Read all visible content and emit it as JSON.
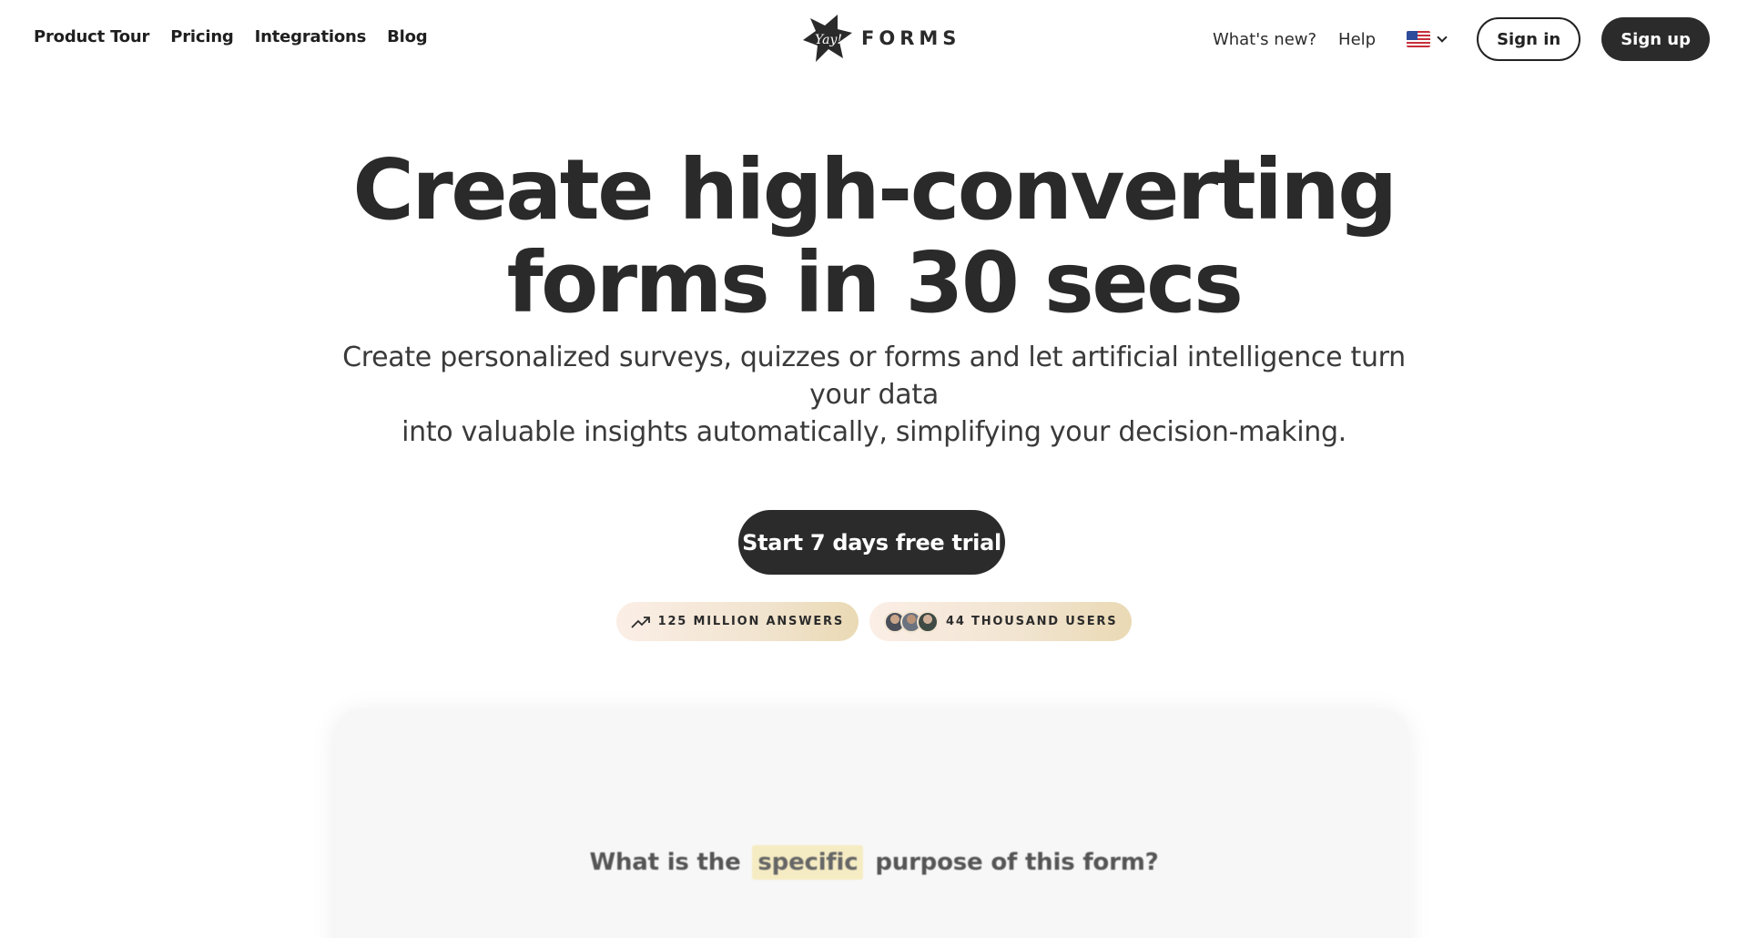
{
  "header": {
    "nav_left": [
      {
        "label": "Product Tour"
      },
      {
        "label": "Pricing"
      },
      {
        "label": "Integrations"
      },
      {
        "label": "Blog"
      }
    ],
    "logo": {
      "mark_text": "Yay!",
      "text": "FORMS"
    },
    "nav_right": {
      "whats_new": "What's new?",
      "help": "Help",
      "language_icon": "us-flag-icon",
      "sign_in": "Sign in",
      "sign_up": "Sign up"
    }
  },
  "hero": {
    "title_line1": "Create high-converting",
    "title_line2": "forms in 30 secs",
    "subtitle_line1": "Create personalized surveys, quizzes or forms and let artificial intelligence turn your data",
    "subtitle_line2": "into valuable insights automatically, simplifying your decision-making.",
    "cta_label": "Start 7 days free trial",
    "stats": {
      "answers": "125 MILLION ANSWERS",
      "users": "44 THOUSAND USERS"
    }
  },
  "preview": {
    "question_before": "What is the",
    "question_highlight": "specific",
    "question_after": "purpose of this form?"
  },
  "colors": {
    "primary_dark": "#2b2b2b",
    "pill_gradient_start": "#fbeee6",
    "pill_gradient_end": "#ead9b4",
    "highlight": "#f6ecc4"
  }
}
